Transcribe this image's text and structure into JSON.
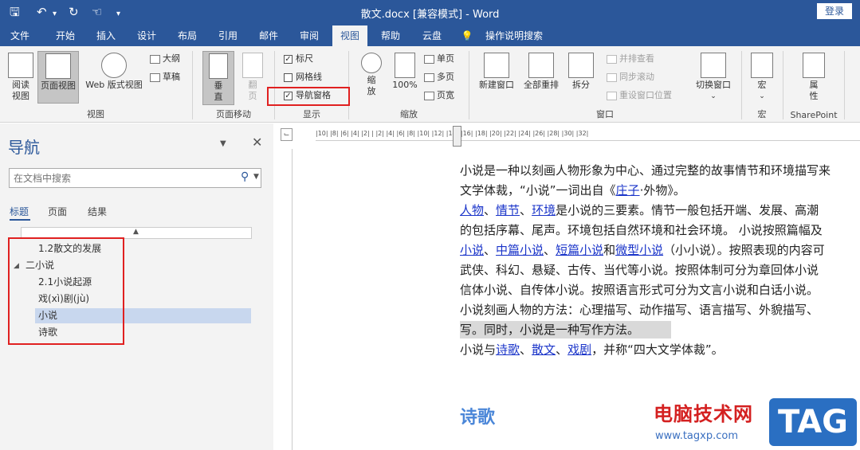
{
  "titlebar": {
    "title": "散文.docx [兼容模式] - Word",
    "login": "登录"
  },
  "tabs": [
    "文件",
    "开始",
    "插入",
    "设计",
    "布局",
    "引用",
    "邮件",
    "审阅",
    "视图",
    "帮助",
    "云盘",
    "操作说明搜索"
  ],
  "ribbon": {
    "view_group": {
      "read": "阅读\n视图",
      "page": "页面视图",
      "web": "Web 版式视图",
      "outline": "大纲",
      "draft": "草稿",
      "label": "视图"
    },
    "move_group": {
      "vertical": "垂\n直",
      "flip": "翻\n页",
      "label": "页面移动"
    },
    "show_group": {
      "ruler": "标尺",
      "grid": "网格线",
      "nav": "导航窗格",
      "label": "显示"
    },
    "zoom_group": {
      "zoom": "缩\n放",
      "hundred": "100%",
      "one": "单页",
      "multi": "多页",
      "width": "页宽",
      "label": "缩放"
    },
    "window_group": {
      "new": "新建窗口",
      "arrange": "全部重排",
      "split": "拆分",
      "side": "并排查看",
      "sync": "同步滚动",
      "reset": "重设窗口位置",
      "switch": "切换窗口",
      "label": "窗口"
    },
    "macro_group": {
      "macro": "宏",
      "label": "宏"
    },
    "sp_group": {
      "prop": "属\n性",
      "label": "SharePoint"
    }
  },
  "nav": {
    "title": "导航",
    "search_placeholder": "在文档中搜索",
    "tabs": [
      "标题",
      "页面",
      "结果"
    ],
    "items": [
      "1.2散文的发展",
      "二小说",
      "2.1小说起源",
      "戏(xì)剧(jù)",
      "小说",
      "诗歌"
    ]
  },
  "ruler_text": "|10|  |8|  |6|  |4|  |2|  |  |2|  |4|  |6|  |8|  |10|  |12|  |14|  |16|  |18|  |20|  |22|  |24|  |26|  |28|  |30|  |32|",
  "doc": {
    "lines": [
      "小说是一种以刻画人物形象为中心、通过完整的故事情节和环境描写来",
      "文学体裁，“小说”一词出自《庄子·外物》。",
      "人物、情节、环境是小说的三要素。情节一般包括开端、发展、高潮",
      "的包括序幕、尾声。环境包括自然环境和社会环境。 小说按照篇幅及",
      "小说、中篇小说、短篇小说和微型小说（小小说）。按照表现的内容可",
      "武侠、科幻、悬疑、古传、当代等小说。按照体制可分为章回体小说",
      "信体小说、自传体小说。按照语言形式可分为文言小说和白话小说。",
      "小说刻画人物的方法：心理描写、动作描写、语言描写、外貌描写、",
      "写。同时，小说是一种写作方法。",
      "小说与诗歌、散文、戏剧，并称“四大文学体裁”。"
    ],
    "heading": "诗歌"
  },
  "watermark": {
    "site": "电脑技术网",
    "url": "www.tagxp.com",
    "tag": "TAG"
  }
}
